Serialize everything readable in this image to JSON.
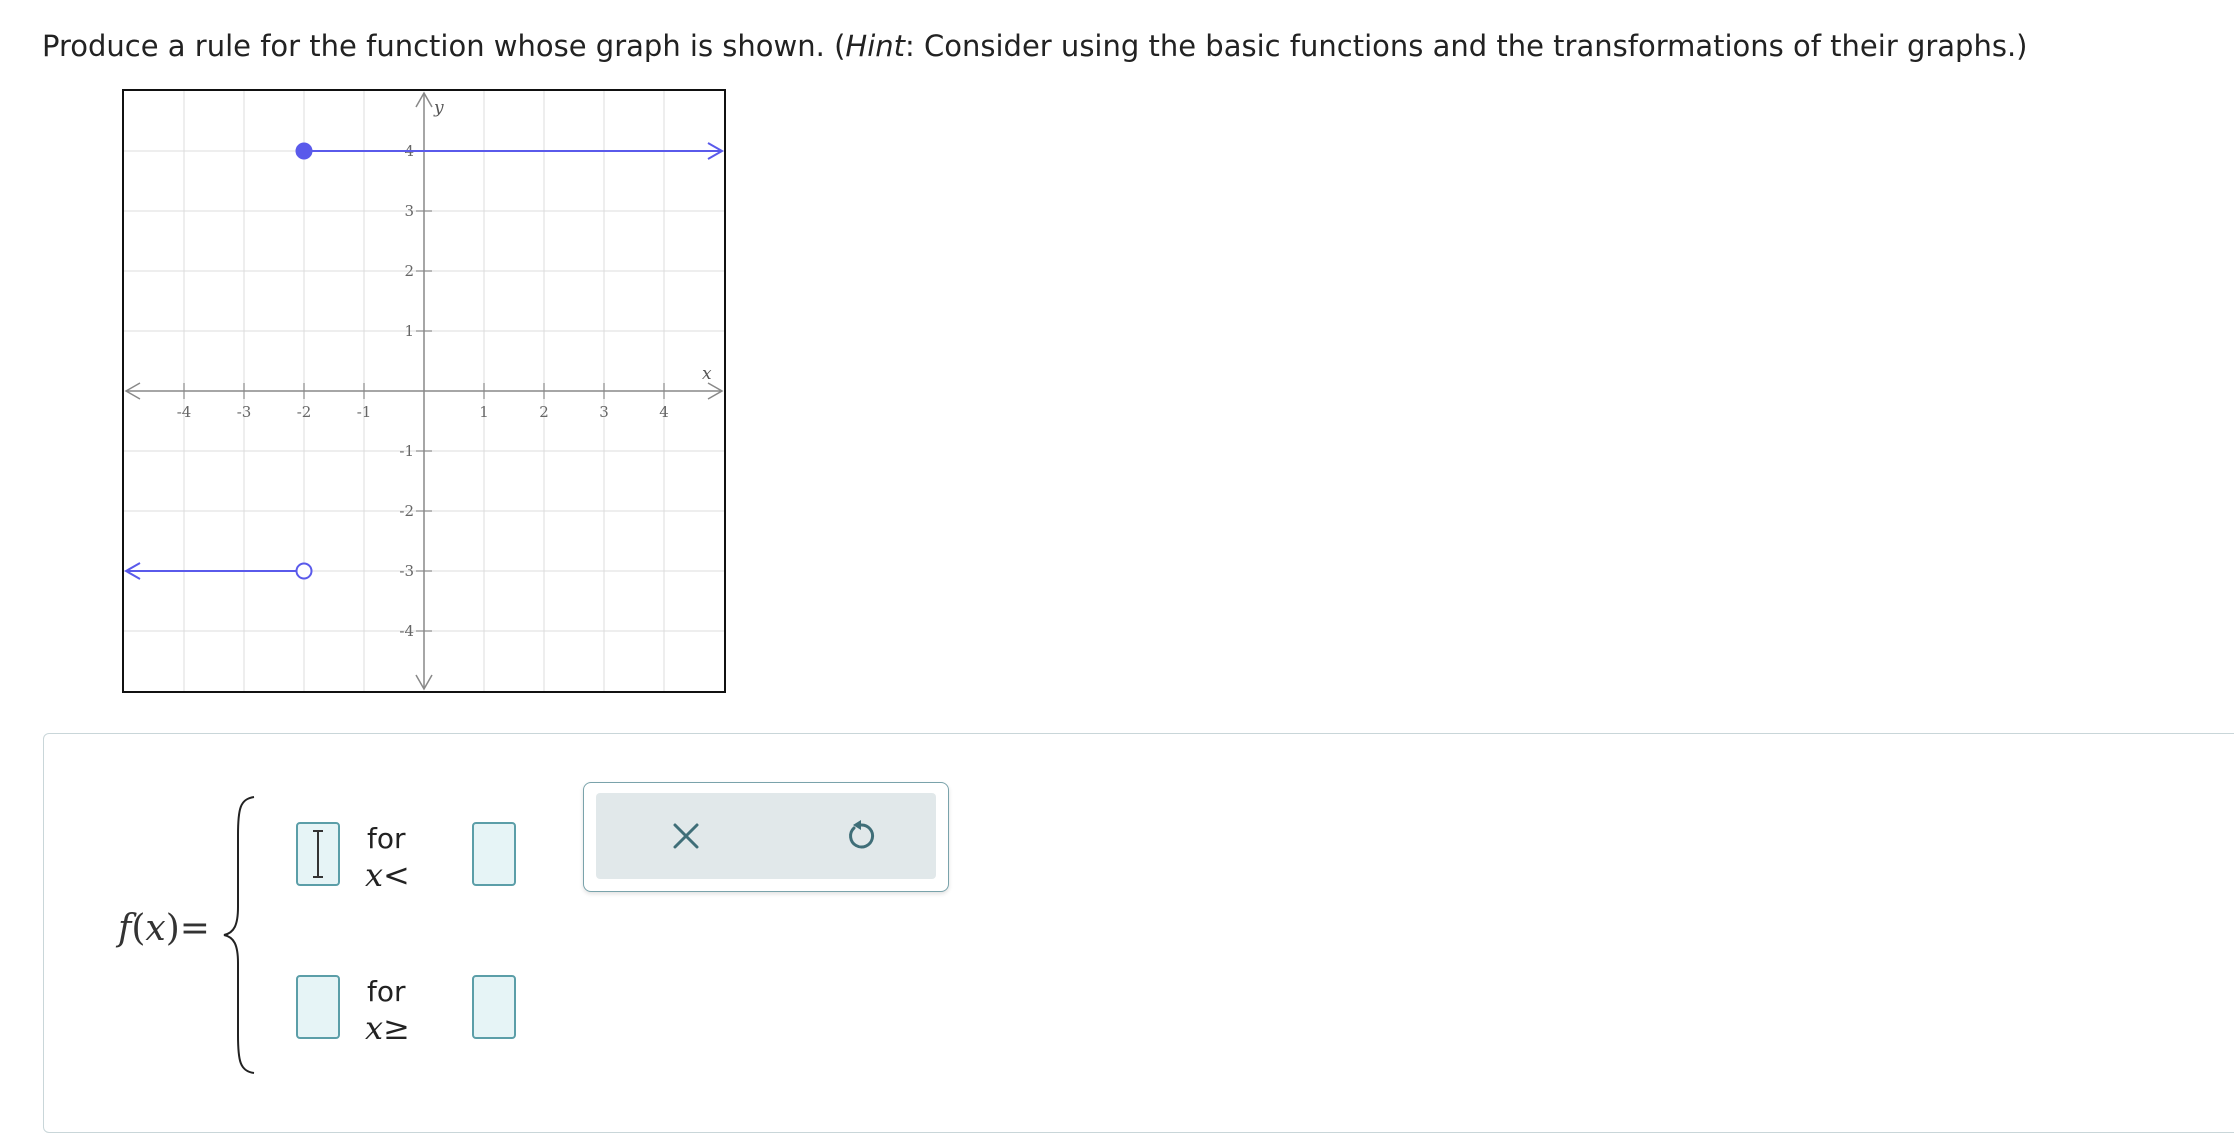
{
  "prompt": {
    "before": "Produce a rule for the function whose graph is shown. (",
    "hint_word": "Hint",
    "after": ": Consider using the basic functions and the transformations of their graphs.)"
  },
  "graph": {
    "x_axis_label": "x",
    "y_axis_label": "y",
    "x_range": [
      -5,
      5
    ],
    "y_range": [
      -5,
      5
    ],
    "x_ticks": [
      "-4",
      "-3",
      "-2",
      "-1",
      "1",
      "2",
      "3",
      "4"
    ],
    "y_ticks": [
      "4",
      "3",
      "2",
      "1",
      "-1",
      "-2",
      "-3",
      "-4"
    ],
    "line_color": "#5a5aeb",
    "pieces": [
      {
        "y": 4,
        "x_start": -2,
        "start": "closed",
        "direction": "right"
      },
      {
        "y": -3,
        "x_end": -2,
        "end": "open",
        "direction": "left"
      }
    ]
  },
  "answer": {
    "fx": {
      "f": "f",
      "open": "(",
      "x": "x",
      "close": ")",
      "eq": "="
    },
    "rows": [
      {
        "for_label": "for",
        "var": "x",
        "relation": "<",
        "value": "",
        "bound": ""
      },
      {
        "for_label": "for",
        "var": "x",
        "relation": "≥",
        "value": "",
        "bound": ""
      }
    ]
  },
  "tools": {
    "clear": "clear-button",
    "undo": "undo-button",
    "icon_color": "#3f6e78"
  }
}
